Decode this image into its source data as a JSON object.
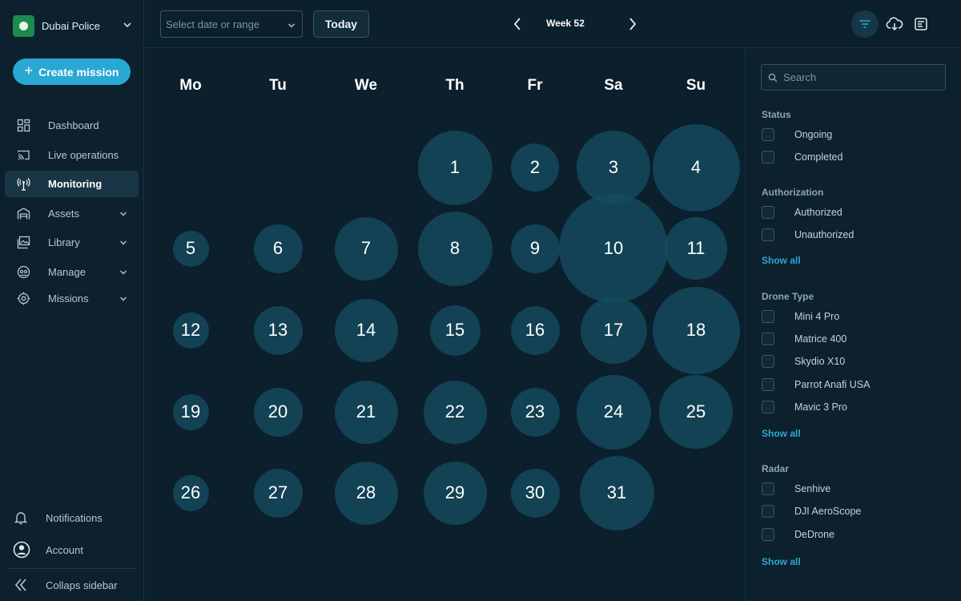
{
  "sidebar": {
    "org_name": "Dubai Police",
    "create_label": "Create mission",
    "items": [
      {
        "label": "Dashboard"
      },
      {
        "label": "Live operations"
      },
      {
        "label": "Monitoring"
      },
      {
        "label": "Assets"
      },
      {
        "label": "Library"
      },
      {
        "label": "Manage"
      },
      {
        "label": "Missions"
      }
    ],
    "notifications_label": "Notifications",
    "account_label": "Account",
    "collapse_label": "Collaps sidebar"
  },
  "topbar": {
    "date_placeholder": "Select date or range",
    "today_label": "Today",
    "week_label": "Week 52"
  },
  "calendar": {
    "weekdays": [
      "Mo",
      "Tu",
      "We",
      "Th",
      "Fr",
      "Sa",
      "Su"
    ],
    "days": [
      "1",
      "2",
      "3",
      "4",
      "5",
      "6",
      "7",
      "8",
      "9",
      "10",
      "11",
      "12",
      "13",
      "14",
      "15",
      "16",
      "17",
      "18",
      "19",
      "20",
      "21",
      "22",
      "23",
      "24",
      "25",
      "26",
      "27",
      "28",
      "29",
      "30",
      "31"
    ]
  },
  "filters": {
    "search_placeholder": "Search",
    "status": {
      "title": "Status",
      "options": [
        "Ongoing",
        "Completed"
      ]
    },
    "authorization": {
      "title": "Authorization",
      "options": [
        "Authorized",
        "Unauthorized"
      ],
      "show_all": "Show all"
    },
    "drone_type": {
      "title": "Drone Type",
      "options": [
        "Mini 4 Pro",
        "Matrice 400",
        "Skydio X10",
        "Parrot Anafi USA",
        "Mavic 3 Pro"
      ],
      "show_all": "Show all"
    },
    "radar": {
      "title": "Radar",
      "options": [
        "Senhive",
        "DJI AeroScope",
        "DeDrone"
      ],
      "show_all": "Show all"
    }
  },
  "colors": {
    "background": "#0b1f2c",
    "accent": "#2aa8d4",
    "day_bubble": "#154d60"
  }
}
